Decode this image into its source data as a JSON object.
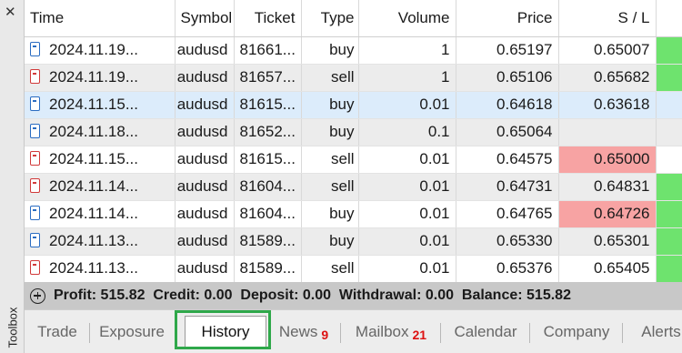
{
  "toolbox": {
    "label": "Toolbox",
    "close_glyph": "✕"
  },
  "columns": [
    "Time",
    "Symbol",
    "Ticket",
    "Type",
    "Volume",
    "Price",
    "S / L"
  ],
  "rows": [
    {
      "time": "2024.11.19...",
      "symbol": "audusd",
      "ticket": "81661...",
      "type": "buy",
      "volume": "1",
      "price": "0.65197",
      "sl": "0.65007",
      "sl_state": "normal",
      "tp_state": "green"
    },
    {
      "time": "2024.11.19...",
      "symbol": "audusd",
      "ticket": "81657...",
      "type": "sell",
      "volume": "1",
      "price": "0.65106",
      "sl": "0.65682",
      "sl_state": "normal",
      "tp_state": "green"
    },
    {
      "time": "2024.11.15...",
      "symbol": "audusd",
      "ticket": "81615...",
      "type": "buy",
      "volume": "0.01",
      "price": "0.64618",
      "sl": "0.63618",
      "sl_state": "normal",
      "tp_state": "none"
    },
    {
      "time": "2024.11.18...",
      "symbol": "audusd",
      "ticket": "81652...",
      "type": "buy",
      "volume": "0.1",
      "price": "0.65064",
      "sl": "",
      "sl_state": "normal",
      "tp_state": "none"
    },
    {
      "time": "2024.11.15...",
      "symbol": "audusd",
      "ticket": "81615...",
      "type": "sell",
      "volume": "0.01",
      "price": "0.64575",
      "sl": "0.65000",
      "sl_state": "red",
      "tp_state": "none"
    },
    {
      "time": "2024.11.14...",
      "symbol": "audusd",
      "ticket": "81604...",
      "type": "sell",
      "volume": "0.01",
      "price": "0.64731",
      "sl": "0.64831",
      "sl_state": "normal",
      "tp_state": "green"
    },
    {
      "time": "2024.11.14...",
      "symbol": "audusd",
      "ticket": "81604...",
      "type": "buy",
      "volume": "0.01",
      "price": "0.64765",
      "sl": "0.64726",
      "sl_state": "red",
      "tp_state": "green"
    },
    {
      "time": "2024.11.13...",
      "symbol": "audusd",
      "ticket": "81589...",
      "type": "buy",
      "volume": "0.01",
      "price": "0.65330",
      "sl": "0.65301",
      "sl_state": "normal",
      "tp_state": "green"
    },
    {
      "time": "2024.11.13...",
      "symbol": "audusd",
      "ticket": "81589...",
      "type": "sell",
      "volume": "0.01",
      "price": "0.65376",
      "sl": "0.65405",
      "sl_state": "normal",
      "tp_state": "green"
    }
  ],
  "summary": {
    "text": "Profit: 515.82  Credit: 0.00  Deposit: 0.00  Withdrawal: 0.00  Balance: 515.82"
  },
  "tabs": [
    {
      "label": "Trade",
      "count": ""
    },
    {
      "label": "Exposure",
      "count": ""
    },
    {
      "label": "History",
      "count": "",
      "active": true
    },
    {
      "label": "News",
      "count": "9"
    },
    {
      "label": "Mailbox",
      "count": "21"
    },
    {
      "label": "Calendar",
      "count": ""
    },
    {
      "label": "Company",
      "count": ""
    },
    {
      "label": "Alerts",
      "count": ""
    }
  ],
  "colors": {
    "sl_red": "#f7a3a3",
    "tp_green": "#6ee36e",
    "selected_row": "#dcecfb",
    "highlight": "#2fa84a"
  }
}
